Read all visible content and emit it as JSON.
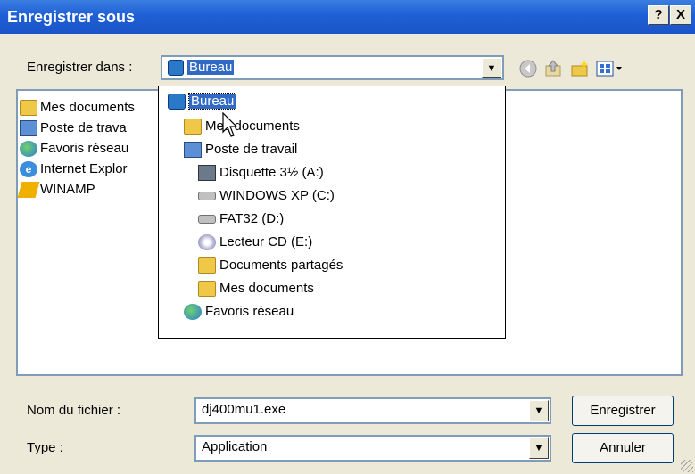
{
  "window": {
    "title": "Enregistrer sous",
    "help_label": "?",
    "close_label": "X"
  },
  "save_in": {
    "label": "Enregistrer dans :",
    "value": "Bureau",
    "value_icon": "desktop-icon"
  },
  "toolbar": {
    "back_icon": "back-icon",
    "up_icon": "up-folder-icon",
    "new_folder_icon": "new-folder-icon",
    "view_icon": "view-menu-icon"
  },
  "file_list": {
    "items": [
      {
        "label": "Mes documents",
        "icon": "folder-icon"
      },
      {
        "label": "Poste de trava",
        "icon": "computer-icon"
      },
      {
        "label": "Favoris réseau",
        "icon": "network-icon"
      },
      {
        "label": "Internet Explor",
        "icon": "ie-icon"
      },
      {
        "label": "WINAMP",
        "icon": "winamp-icon"
      }
    ]
  },
  "dropdown": {
    "items": [
      {
        "label": "Bureau",
        "icon": "desktop-icon",
        "selected": true
      },
      {
        "label": "Mes documents",
        "icon": "folder-icon"
      },
      {
        "label": "Poste de travail",
        "icon": "computer-icon"
      },
      {
        "label": "Disquette 3½ (A:)",
        "icon": "floppy-icon"
      },
      {
        "label": "WINDOWS XP (C:)",
        "icon": "drive-icon"
      },
      {
        "label": "FAT32 (D:)",
        "icon": "drive-icon"
      },
      {
        "label": "Lecteur CD (E:)",
        "icon": "cd-icon"
      },
      {
        "label": "Documents partagés",
        "icon": "folder-icon"
      },
      {
        "label": "Mes documents",
        "icon": "folder-icon"
      },
      {
        "label": "Favoris réseau",
        "icon": "network-icon"
      }
    ]
  },
  "filename": {
    "label": "Nom du fichier :",
    "value": "dj400mu1.exe"
  },
  "filetype": {
    "label": "Type :",
    "value": "Application"
  },
  "buttons": {
    "save": "Enregistrer",
    "cancel": "Annuler"
  }
}
